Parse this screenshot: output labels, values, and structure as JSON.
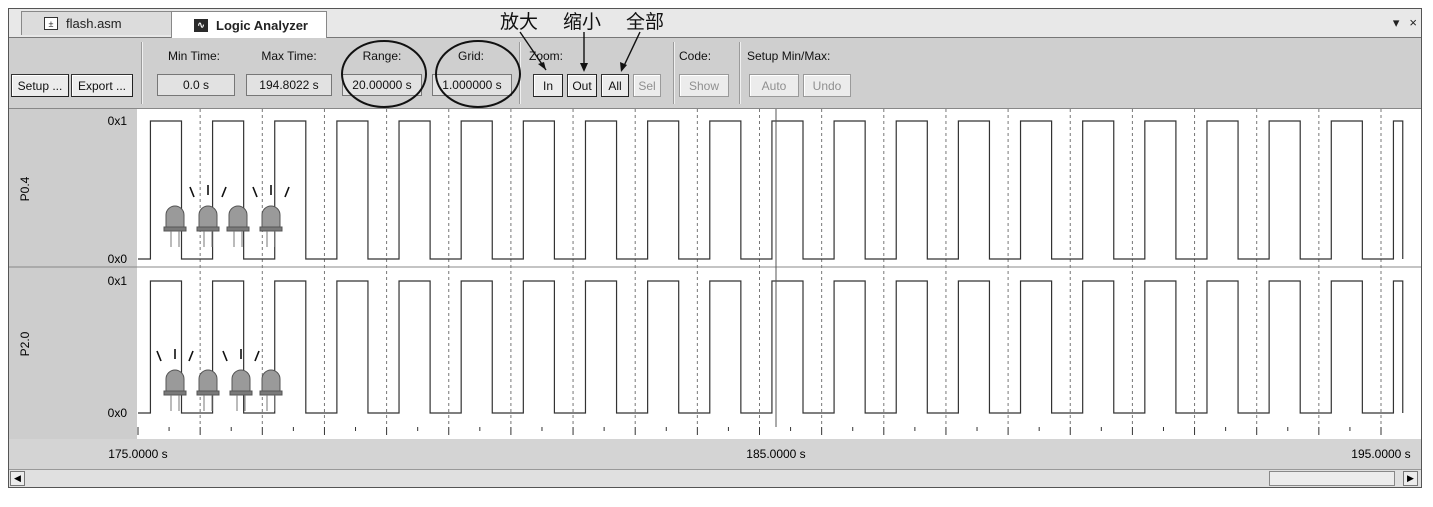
{
  "tabs": [
    {
      "label": "flash.asm",
      "icon": "asm-file-icon",
      "active": false
    },
    {
      "label": "Logic Analyzer",
      "icon": "logic-analyzer-icon",
      "active": true
    }
  ],
  "window_controls": {
    "dropdown": "▾",
    "close": "×"
  },
  "toolbar": {
    "setup_label": "Setup ...",
    "export_label": "Export ...",
    "min_time_label": "Min Time:",
    "min_time_value": "0.0 s",
    "max_time_label": "Max Time:",
    "max_time_value": "194.8022 s",
    "range_label": "Range:",
    "range_value": "20.00000 s",
    "grid_label": "Grid:",
    "grid_value": "1.000000 s",
    "zoom_label": "Zoom:",
    "zoom_in_label": "In",
    "zoom_out_label": "Out",
    "zoom_all_label": "All",
    "zoom_sel_label": "Sel",
    "code_label": "Code:",
    "show_label": "Show",
    "setup_minmax_label": "Setup Min/Max:",
    "auto_label": "Auto",
    "undo_label": "Undo"
  },
  "annotations": {
    "zoom_in": "放大",
    "zoom_out": "缩小",
    "zoom_all": "全部"
  },
  "signals": [
    {
      "name": "P0.4",
      "high_label": "0x1",
      "low_label": "0x0"
    },
    {
      "name": "P2.0",
      "high_label": "0x1",
      "low_label": "0x0"
    }
  ],
  "time_axis": {
    "start_label": "175.0000 s",
    "mid_label": "185.0000 s",
    "end_label": "195.0000 s"
  },
  "waveform": {
    "start_time": 175.0,
    "end_time": 195.0,
    "period": 1.0,
    "p0_4_first_high": 175.2,
    "p2_0_first_high": 175.2,
    "duty": 0.5,
    "visible_grid_every": 1.0
  },
  "colors": {
    "waveform": "#333333",
    "background": "#ffffff",
    "panel": "#d4d4d4",
    "cursor": "#555555"
  }
}
